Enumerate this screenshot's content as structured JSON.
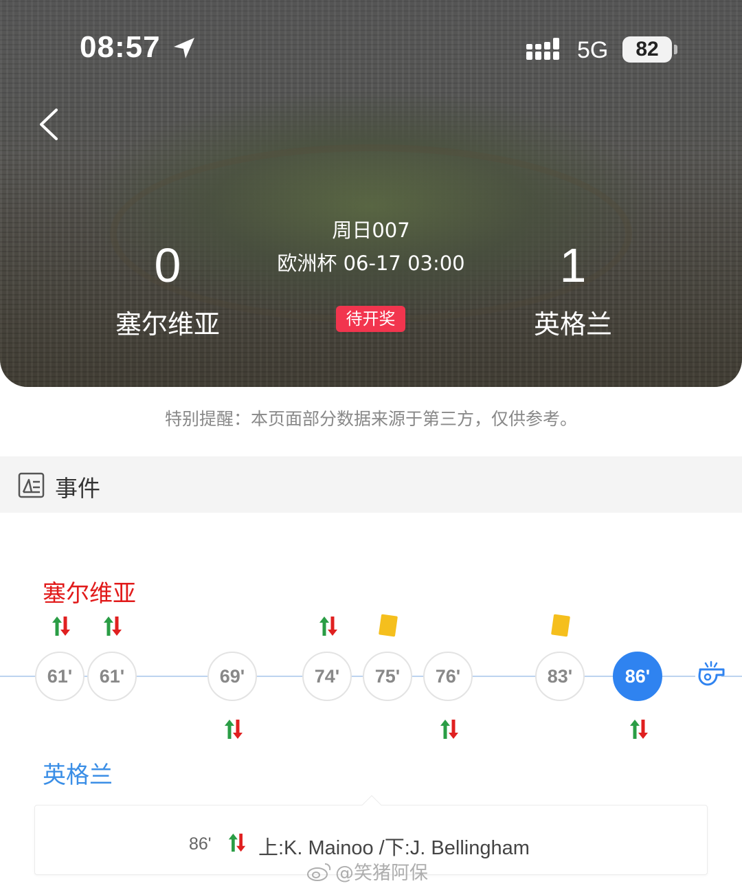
{
  "status_bar": {
    "time": "08:57",
    "network": "5G",
    "battery": "82"
  },
  "match": {
    "number": "周日007",
    "info": "欧洲杯 06-17 03:00",
    "home_team": "塞尔维亚",
    "away_team": "英格兰",
    "home_score": "0",
    "away_score": "1",
    "status_badge": "待开奖"
  },
  "notice": "特别提醒：本页面部分数据来源于第三方，仅供参考。",
  "section": {
    "title": "事件",
    "icon": "event-list-icon"
  },
  "timeline": {
    "home_label": "塞尔维亚",
    "away_label": "英格兰",
    "minutes": [
      "61'",
      "61'",
      "69'",
      "74'",
      "75'",
      "76'",
      "83'",
      "86'"
    ],
    "active_minute": "86'",
    "events": [
      {
        "minute": "61'",
        "side": "home",
        "type": "substitution"
      },
      {
        "minute": "61'",
        "side": "home",
        "type": "substitution"
      },
      {
        "minute": "69'",
        "side": "away",
        "type": "substitution"
      },
      {
        "minute": "74'",
        "side": "home",
        "type": "substitution"
      },
      {
        "minute": "75'",
        "side": "home",
        "type": "yellow-card"
      },
      {
        "minute": "76'",
        "side": "away",
        "type": "substitution"
      },
      {
        "minute": "83'",
        "side": "home",
        "type": "yellow-card"
      },
      {
        "minute": "86'",
        "side": "away",
        "type": "substitution"
      }
    ]
  },
  "detail": {
    "minute": "86'",
    "text": "上:K. Mainoo /下:J. Bellingham"
  },
  "watermark": "@笑猪阿保",
  "colors": {
    "badge": "#f2354e",
    "home": "#e11a1a",
    "away": "#3a8ee6",
    "active": "#2f83f0",
    "yellow_card": "#f5bf1d",
    "sub_up": "#2a9d45",
    "sub_down": "#e02020"
  }
}
